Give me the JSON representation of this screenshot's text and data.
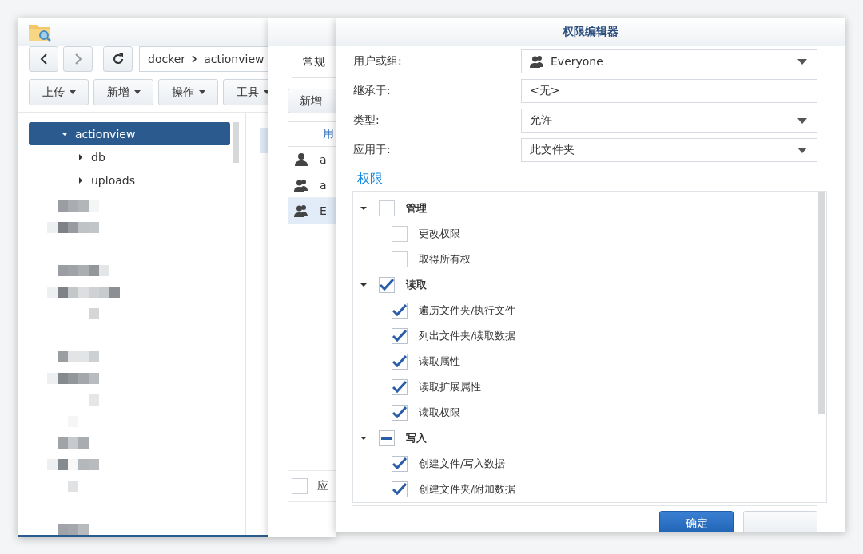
{
  "file_station": {
    "path": [
      "docker",
      "actionview"
    ],
    "toolbar": [
      "上传",
      "新增",
      "操作",
      "工具"
    ],
    "tree": [
      {
        "label": "actionview",
        "selected": true,
        "expanded": true,
        "children": [
          {
            "label": "db",
            "expanded": false
          },
          {
            "label": "uploads",
            "expanded": false
          }
        ]
      }
    ]
  },
  "properties": {
    "tab": "常规",
    "add_button": "新增",
    "column": "用",
    "rows": [
      {
        "kind": "user",
        "name": "a",
        "selected": false
      },
      {
        "kind": "group",
        "name": "a",
        "selected": false
      },
      {
        "kind": "group",
        "name": "E",
        "selected": true
      }
    ],
    "apply_checkbox": {
      "label": "应",
      "checked": false
    }
  },
  "editor": {
    "title": "权限编辑器",
    "fields": [
      {
        "label": "用户或组:",
        "value": "Everyone",
        "kind": "group-dropdown"
      },
      {
        "label": "继承于:",
        "value": "<无>",
        "kind": "text"
      },
      {
        "label": "类型:",
        "value": "允许",
        "kind": "dropdown"
      },
      {
        "label": "应用于:",
        "value": "此文件夹",
        "kind": "dropdown"
      }
    ],
    "permissions_title": "权限",
    "permissions": [
      {
        "label": "管理",
        "checked": false,
        "expanded": true,
        "children": [
          {
            "label": "更改权限",
            "checked": false
          },
          {
            "label": "取得所有权",
            "checked": false
          }
        ]
      },
      {
        "label": "读取",
        "checked": true,
        "expanded": true,
        "children": [
          {
            "label": "遍历文件夹/执行文件",
            "checked": true
          },
          {
            "label": "列出文件夹/读取数据",
            "checked": true
          },
          {
            "label": "读取属性",
            "checked": true
          },
          {
            "label": "读取扩展属性",
            "checked": true
          },
          {
            "label": "读取权限",
            "checked": true
          }
        ]
      },
      {
        "label": "写入",
        "partial": true,
        "expanded": true,
        "children": [
          {
            "label": "创建文件/写入数据",
            "checked": true
          },
          {
            "label": "创建文件夹/附加数据",
            "checked": true
          }
        ]
      }
    ],
    "buttons": [
      {
        "label": "确定",
        "kind": "primary"
      },
      {
        "kind": "secondary"
      }
    ]
  }
}
